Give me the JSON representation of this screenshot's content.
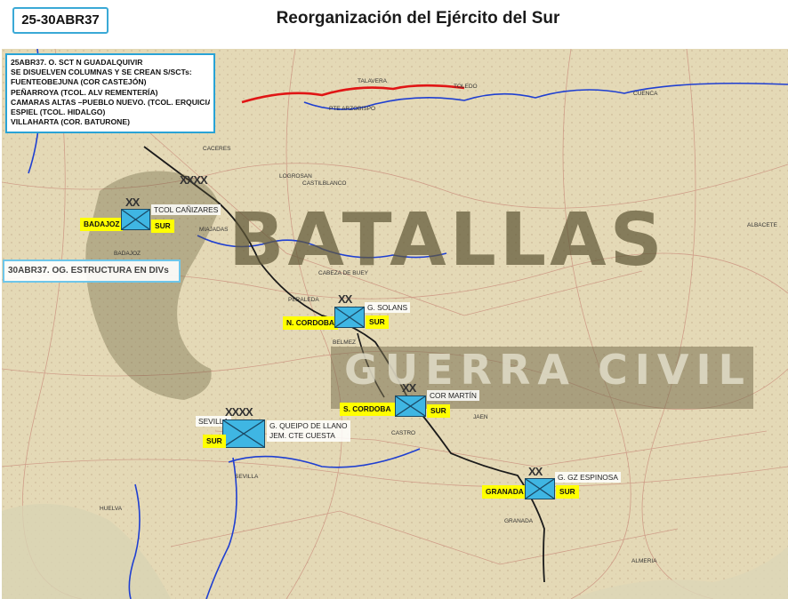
{
  "header": {
    "date_range": "25-30ABR37",
    "title": "Reorganización del Ejército del Sur"
  },
  "info_box": {
    "lines": [
      "25ABR37. O. SCT N GUADALQUIVIR",
      "SE DISUELVEN COLUMNAS Y SE CREAN S/SCTs:",
      "FUENTEOBEJUNA (COR CASTEJÓN)",
      "PEÑARROYA (TCOL. ALV REMENTERÍA)",
      "CAMARAS ALTAS –PUEBLO NUEVO. (TCOL. ERQUICIA)",
      "ESPIEL (TCOL. HIDALGO)",
      "VILLAHARTA (COR. BATURONE)"
    ]
  },
  "phase_note": "30ABR37. OG. ESTRUCTURA EN DIVs",
  "watermark": {
    "line1": "BATALLAS",
    "line2": "GUERRA CIVIL"
  },
  "map_places": {
    "caceres": "CACERES",
    "badajoz_town": "BADAJOZ",
    "miajadas": "MIAJADAS",
    "logrosan": "LOGROSAN",
    "castilblanco": "CASTILBLANCO",
    "cabeza_de_buey": "CABEZA DE BUEY",
    "peraleda": "PERALEDA",
    "belmez": "BELMEZ",
    "castro": "CASTRO",
    "huelva": "HUELVA",
    "sevilla_town": "SEVILLA",
    "granada_town": "GRANADA",
    "jaen": "JAEN",
    "almeria": "ALMERIA",
    "cuenca": "CUENCA",
    "albacete": "ALBACETE",
    "talavera": "TALAVERA",
    "pte_arzobispo": "PTE ARZOBISPO",
    "toledo": "TOLEDO"
  },
  "units": [
    {
      "id": "badajoz",
      "echelon": "XX",
      "place": "BADAJOZ",
      "army": "SUR",
      "commander": "TCOL CAÑIZARES"
    },
    {
      "id": "n-cordoba",
      "echelon": "XX",
      "place": "N. CORDOBA",
      "army": "SUR",
      "commander": "G. SOLANS"
    },
    {
      "id": "s-cordoba",
      "echelon": "XX",
      "place": "S. CORDOBA",
      "army": "SUR",
      "commander": "COR MARTÍN"
    },
    {
      "id": "sevilla",
      "echelon": "XXXX",
      "place": "SEVILLA",
      "army": "SUR",
      "commander": "G. QUEIPO DE LLANO",
      "commander2": "JEM. CTE CUESTA"
    },
    {
      "id": "granada",
      "echelon": "XX",
      "place": "GRANADA",
      "army": "SUR",
      "commander": "G. GZ ESPINOSA"
    }
  ],
  "front_echelon": "XXXX",
  "colors": {
    "accent_border": "#29a3d6",
    "unit_fill": "#3fb6e3",
    "label_highlight": "#ffff00",
    "river": "#1f3fd1",
    "railway_red": "#e01515",
    "map_paper": "#e4d9b6"
  }
}
